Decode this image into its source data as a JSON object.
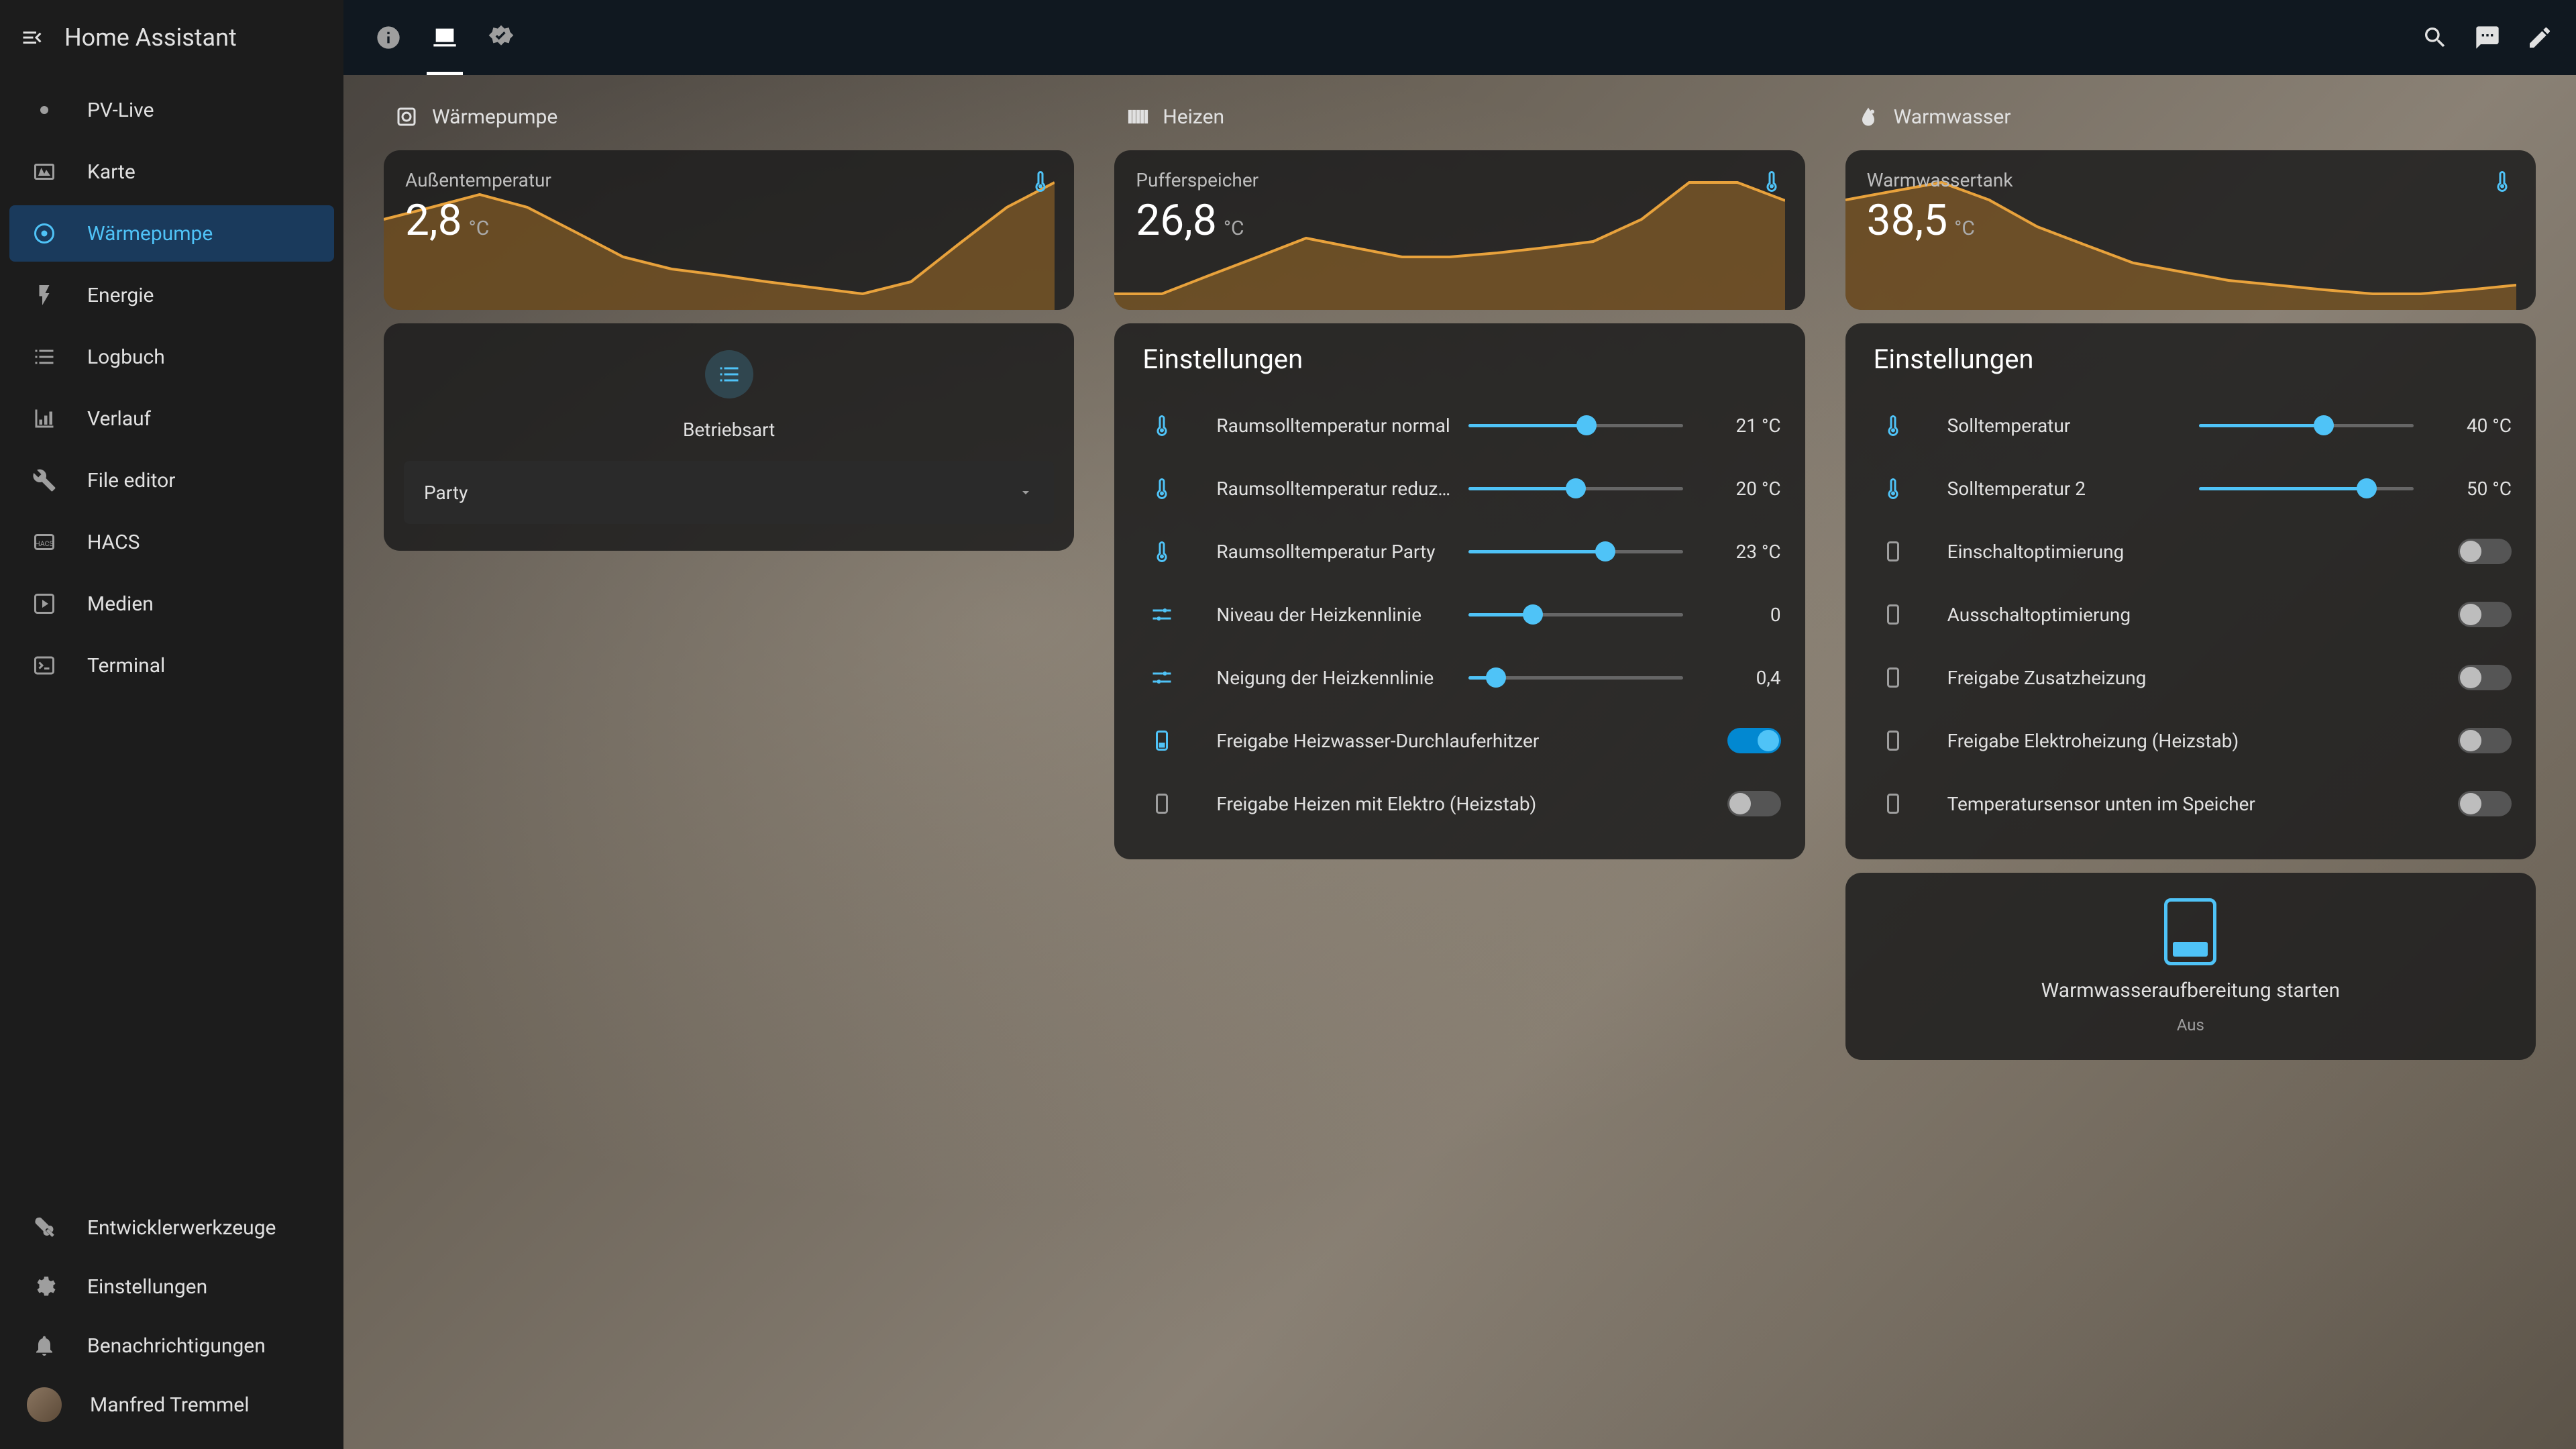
{
  "app_title": "Home Assistant",
  "sidebar": {
    "items": [
      {
        "id": "pv-live",
        "label": "PV-Live",
        "icon": "sun"
      },
      {
        "id": "karte",
        "label": "Karte",
        "icon": "map"
      },
      {
        "id": "waermepumpe",
        "label": "Wärmepumpe",
        "icon": "target",
        "active": true
      },
      {
        "id": "energie",
        "label": "Energie",
        "icon": "bolt"
      },
      {
        "id": "logbuch",
        "label": "Logbuch",
        "icon": "list"
      },
      {
        "id": "verlauf",
        "label": "Verlauf",
        "icon": "chart"
      },
      {
        "id": "file-editor",
        "label": "File editor",
        "icon": "wrench"
      },
      {
        "id": "hacs",
        "label": "HACS",
        "icon": "hacs"
      },
      {
        "id": "medien",
        "label": "Medien",
        "icon": "play"
      },
      {
        "id": "terminal",
        "label": "Terminal",
        "icon": "terminal"
      }
    ],
    "bottom": [
      {
        "id": "dev-tools",
        "label": "Entwicklerwerkzeuge",
        "icon": "hammer"
      },
      {
        "id": "settings",
        "label": "Einstellungen",
        "icon": "gear"
      },
      {
        "id": "notifications",
        "label": "Benachrichtigungen",
        "icon": "bell"
      },
      {
        "id": "user",
        "label": "Manfred Tremmel",
        "icon": "avatar"
      }
    ]
  },
  "columns": [
    {
      "id": "waermepumpe",
      "header": "Wärmepumpe",
      "header_icon": "heatpump",
      "sensor": {
        "label": "Außentemperatur",
        "value": "2,8",
        "unit": "°C"
      },
      "mode": {
        "title": "Betriebsart",
        "value": "Party"
      }
    },
    {
      "id": "heizen",
      "header": "Heizen",
      "header_icon": "radiator",
      "sensor": {
        "label": "Pufferspeicher",
        "value": "26,8",
        "unit": "°C"
      },
      "settings_title": "Einstellungen",
      "settings": [
        {
          "icon": "thermo",
          "label": "Raumsolltemperatur normal",
          "type": "slider",
          "value": "21 °C",
          "pct": 55
        },
        {
          "icon": "thermo",
          "label": "Raumsolltemperatur reduzi…",
          "type": "slider",
          "value": "20 °C",
          "pct": 50
        },
        {
          "icon": "thermo",
          "label": "Raumsolltemperatur Party",
          "type": "slider",
          "value": "23 °C",
          "pct": 64
        },
        {
          "icon": "tune",
          "label": "Niveau der Heizkennlinie",
          "type": "slider",
          "value": "0",
          "pct": 30
        },
        {
          "icon": "tune",
          "label": "Neigung der Heizkennlinie",
          "type": "slider",
          "value": "0,4",
          "pct": 13
        },
        {
          "icon": "device-on",
          "label": "Freigabe Heizwasser-Durchlauferhitzer",
          "type": "toggle",
          "on": true
        },
        {
          "icon": "device",
          "label": "Freigabe Heizen mit Elektro (Heizstab)",
          "type": "toggle",
          "on": false
        }
      ]
    },
    {
      "id": "warmwasser",
      "header": "Warmwasser",
      "header_icon": "water",
      "sensor": {
        "label": "Warmwassertank",
        "value": "38,5",
        "unit": "°C"
      },
      "settings_title": "Einstellungen",
      "settings": [
        {
          "icon": "thermo",
          "label": "Solltemperatur",
          "type": "slider",
          "value": "40 °C",
          "pct": 58
        },
        {
          "icon": "thermo",
          "label": "Solltemperatur 2",
          "type": "slider",
          "value": "50 °C",
          "pct": 78
        },
        {
          "icon": "device",
          "label": "Einschaltoptimierung",
          "type": "toggle",
          "on": false
        },
        {
          "icon": "device",
          "label": "Ausschaltoptimierung",
          "type": "toggle",
          "on": false
        },
        {
          "icon": "device",
          "label": "Freigabe Zusatzheizung",
          "type": "toggle",
          "on": false
        },
        {
          "icon": "device",
          "label": "Freigabe Elektroheizung (Heizstab)",
          "type": "toggle",
          "on": false
        },
        {
          "icon": "device",
          "label": "Temperatursensor unten im Speicher",
          "type": "toggle",
          "on": false
        }
      ],
      "action": {
        "label": "Warmwasseraufbereitung starten",
        "status": "Aus"
      }
    }
  ],
  "chart_data": [
    {
      "type": "line",
      "title": "Außentemperatur",
      "ylabel": "°C",
      "series": [
        {
          "name": "Außentemperatur",
          "values": [
            8,
            9,
            10,
            9,
            7,
            5,
            4,
            3.5,
            3,
            2.5,
            2,
            3,
            6,
            9,
            11
          ]
        }
      ],
      "x": [
        0,
        1,
        2,
        3,
        4,
        5,
        6,
        7,
        8,
        9,
        10,
        11,
        12,
        13,
        14
      ]
    },
    {
      "type": "line",
      "title": "Pufferspeicher",
      "ylabel": "°C",
      "series": [
        {
          "name": "Pufferspeicher",
          "values": [
            24,
            24,
            25,
            26,
            27,
            26.5,
            26,
            26,
            26.2,
            26.5,
            26.8,
            28,
            30,
            30,
            29
          ]
        }
      ],
      "x": [
        0,
        1,
        2,
        3,
        4,
        5,
        6,
        7,
        8,
        9,
        10,
        11,
        12,
        13,
        14
      ]
    },
    {
      "type": "line",
      "title": "Warmwassertank",
      "ylabel": "°C",
      "series": [
        {
          "name": "Warmwassertank",
          "values": [
            48,
            49,
            50,
            48,
            45,
            43,
            41,
            40,
            39,
            38.5,
            38,
            37.5,
            37.5,
            38,
            38.5
          ]
        }
      ],
      "x": [
        0,
        1,
        2,
        3,
        4,
        5,
        6,
        7,
        8,
        9,
        10,
        11,
        12,
        13,
        14
      ]
    }
  ]
}
